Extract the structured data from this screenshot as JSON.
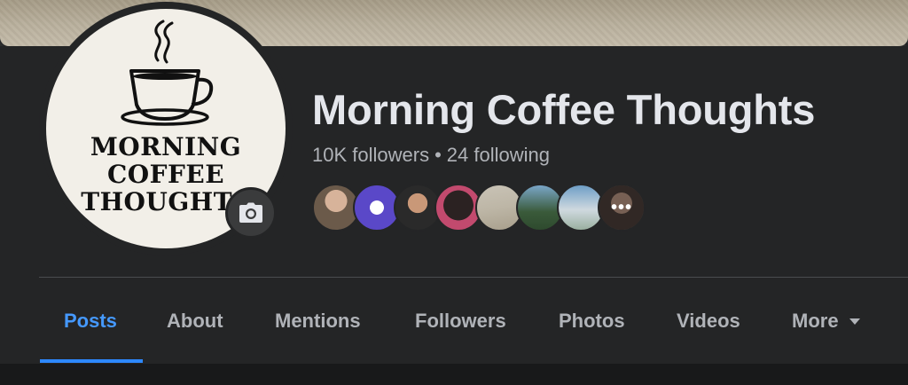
{
  "page": {
    "name": "Morning Coffee Thoughts",
    "followers": "10K followers",
    "separator": "•",
    "following": "24 following",
    "more_followers_indicator": "•••"
  },
  "logo": {
    "line1": "MORNING",
    "line2": "COFFEE",
    "line3": "THOUGHTS"
  },
  "tabs": [
    {
      "label": "Posts",
      "active": true
    },
    {
      "label": "About"
    },
    {
      "label": "Mentions"
    },
    {
      "label": "Followers"
    },
    {
      "label": "Photos"
    },
    {
      "label": "Videos"
    },
    {
      "label": "More"
    }
  ],
  "colors": {
    "background": "#242526",
    "accent": "#2d88ff",
    "text_primary": "#e4e6eb",
    "text_secondary": "#b0b3b8"
  },
  "icons": {
    "camera": "camera-icon",
    "more_caret": "caret-down-icon"
  }
}
